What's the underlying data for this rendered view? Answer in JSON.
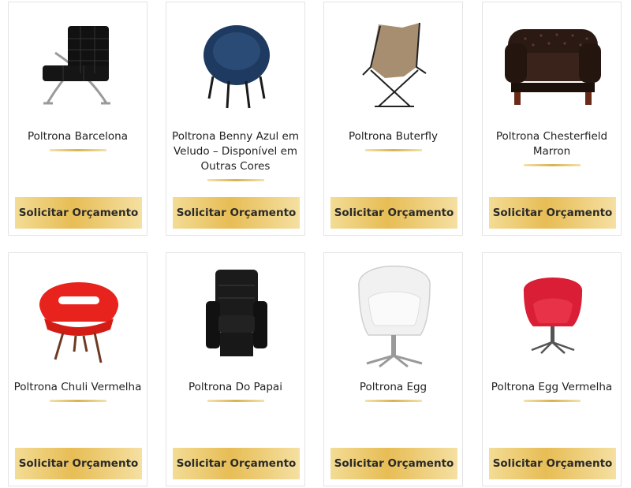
{
  "products": [
    {
      "name": "Poltrona Barcelona",
      "image": "barcelona-chair-icon",
      "button": "Solicitar Orçamento"
    },
    {
      "name": "Poltrona Benny Azul em Veludo – Disponível em Outras Cores",
      "image": "benny-chair-icon",
      "button": "Solicitar Orçamento"
    },
    {
      "name": "Poltrona Buterfly",
      "image": "butterfly-chair-icon",
      "button": "Solicitar Orçamento"
    },
    {
      "name": "Poltrona Chesterfield Marron",
      "image": "chesterfield-chair-icon",
      "button": "Solicitar Orçamento"
    },
    {
      "name": "Poltrona Chuli Vermelha",
      "image": "chuli-chair-icon",
      "button": "Solicitar Orçamento"
    },
    {
      "name": "Poltrona Do Papai",
      "image": "papai-recliner-icon",
      "button": "Solicitar Orçamento"
    },
    {
      "name": "Poltrona Egg",
      "image": "egg-chair-white-icon",
      "button": "Solicitar Orçamento"
    },
    {
      "name": "Poltrona Egg Vermelha",
      "image": "egg-chair-red-icon",
      "button": "Solicitar Orçamento"
    }
  ],
  "colors": {
    "button_gold": "#e7bd55",
    "divider_gold": "#d9b24f"
  }
}
